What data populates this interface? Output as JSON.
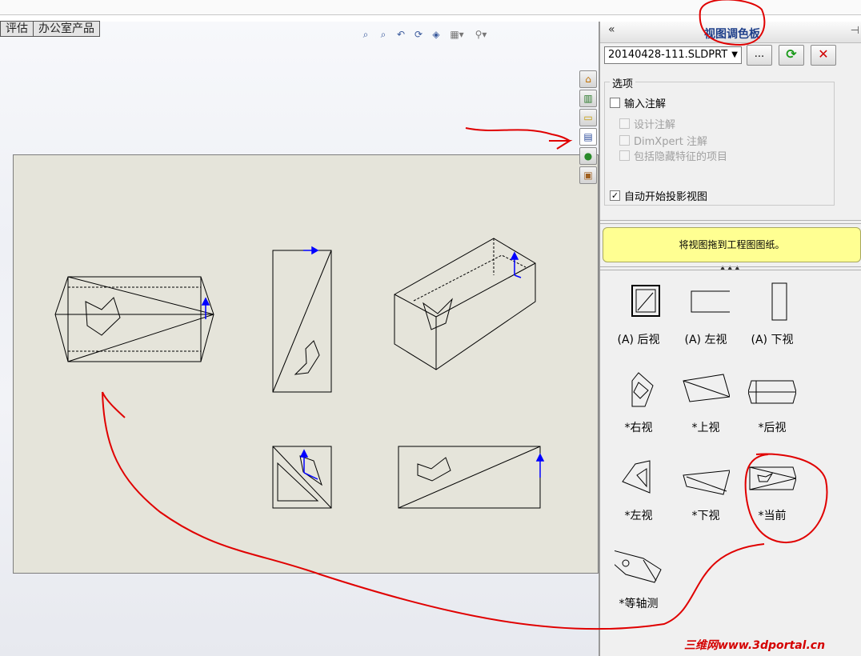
{
  "tabs": [
    "评估",
    "办公室产品"
  ],
  "panel": {
    "title": "视图调色板",
    "collapse_glyph": "«",
    "file": "20140428-111.SLDPRT",
    "browse_label": "...",
    "options_label": "选项",
    "options": [
      {
        "label": "输入注解",
        "checked": false,
        "enabled": true
      },
      {
        "label": "设计注解",
        "checked": false,
        "enabled": false
      },
      {
        "label": "DimXpert 注解",
        "checked": false,
        "enabled": false
      },
      {
        "label": "包括隐藏特征的项目",
        "checked": false,
        "enabled": false
      },
      {
        "label": "自动开始投影视图",
        "checked": true,
        "enabled": true
      }
    ],
    "hint": "将视图拖到工程图图纸。",
    "views": [
      "(A) 后视",
      "(A) 左视",
      "(A) 下视",
      "*右视",
      "*上视",
      "*后视",
      "*左视",
      "*下视",
      "*当前",
      "*等轴测"
    ]
  },
  "watermark": "三维网www.3dportal.cn",
  "colors": {
    "annotation": "#e00000",
    "hint_bg": "#ffff92",
    "sheet_bg": "#e5e4da",
    "axis": "#0000ff"
  },
  "icons": [
    "zoom-to-fit-icon",
    "zoom-area-icon",
    "previous-view-icon",
    "rotate-icon",
    "section-view-icon",
    "display-style-icon",
    "hide-show-icon",
    "home-icon",
    "library-icon",
    "folder-icon",
    "view-palette-icon",
    "appearance-icon",
    "custom-properties-icon"
  ]
}
